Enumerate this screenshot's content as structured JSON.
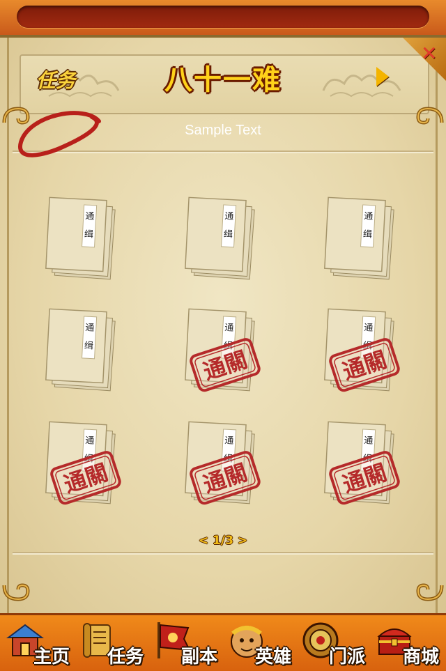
{
  "header": {
    "task_label": "任务",
    "title": "八十一难",
    "info_text": "Sample Text"
  },
  "books": [
    {
      "spine_text": "通 缉",
      "stamp_text": "",
      "cleared": false
    },
    {
      "spine_text": "通 缉",
      "stamp_text": "",
      "cleared": false
    },
    {
      "spine_text": "通 缉",
      "stamp_text": "",
      "cleared": false
    },
    {
      "spine_text": "通 缉",
      "stamp_text": "",
      "cleared": false
    },
    {
      "spine_text": "通 缉",
      "stamp_text": "通關",
      "cleared": true
    },
    {
      "spine_text": "通 缉",
      "stamp_text": "通關",
      "cleared": true
    },
    {
      "spine_text": "通 缉",
      "stamp_text": "通關",
      "cleared": true
    },
    {
      "spine_text": "通 缉",
      "stamp_text": "通關",
      "cleared": true
    },
    {
      "spine_text": "通 缉",
      "stamp_text": "通關",
      "cleared": true
    }
  ],
  "pager": {
    "text": "< 1/3 >",
    "current": 1,
    "total": 3
  },
  "bottom_nav": [
    {
      "label": "主页",
      "icon": "home-house-icon"
    },
    {
      "label": "任务",
      "icon": "task-scroll-icon"
    },
    {
      "label": "副本",
      "icon": "dungeon-banner-icon"
    },
    {
      "label": "英雄",
      "icon": "hero-monkey-king-icon"
    },
    {
      "label": "门派",
      "icon": "sect-shield-icon"
    },
    {
      "label": "商城",
      "icon": "shop-treasure-chest-icon"
    }
  ],
  "colors": {
    "accent_gold": "#ffd21a",
    "stamp_red": "#b52a2a",
    "parchment": "#e9dcb2",
    "nav_orange": "#f08a1a"
  }
}
